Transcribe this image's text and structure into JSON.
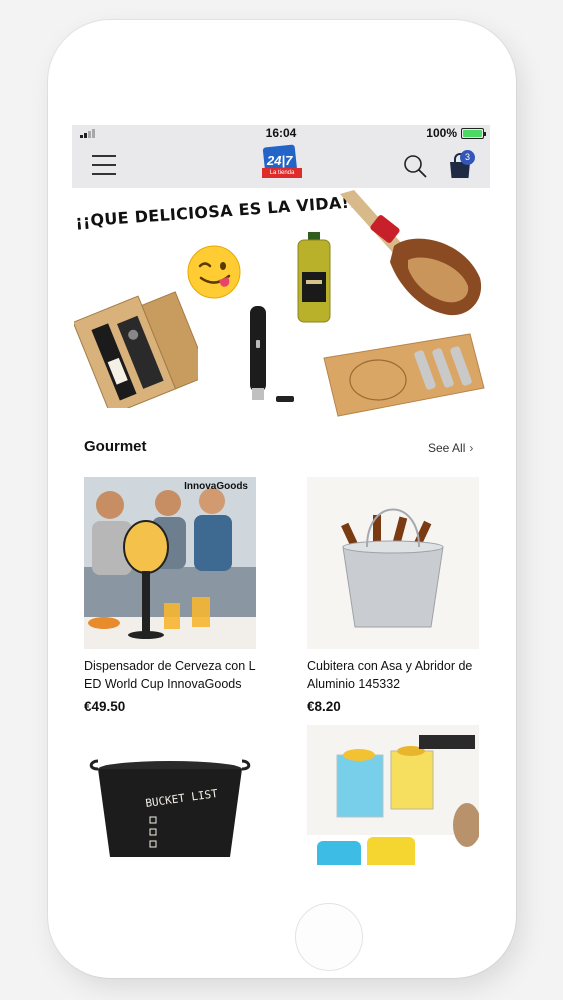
{
  "status_bar": {
    "time": "16:04",
    "battery": "100%"
  },
  "nav": {
    "logo_number": "24|7",
    "logo_sub": "La tienda",
    "cart_count": "3"
  },
  "banner": {
    "headline": "¡¡QUE DELICIOSA ES LA VIDA!!"
  },
  "section": {
    "title": "Gourmet",
    "see_all": "See All"
  },
  "products": [
    {
      "name": "Dispensador de Cerveza con LED World Cup InnovaGoods",
      "price": "€49.50",
      "brand": "InnovaGoods",
      "image": "beer-dispenser-photo"
    },
    {
      "name": "Cubitera con Asa y Abridor de Aluminio 145332",
      "price": "€8.20",
      "image": "ice-bucket-photo"
    },
    {
      "name": "",
      "price": "",
      "image": "bucket-list-bucket-photo"
    },
    {
      "name": "",
      "price": "",
      "image": "party-glasses-photo"
    }
  ],
  "colors": {
    "nav_bg": "#e9e9eb",
    "badge": "#3356b8",
    "logo_blue": "#2364c9",
    "logo_red": "#e02b2b"
  }
}
